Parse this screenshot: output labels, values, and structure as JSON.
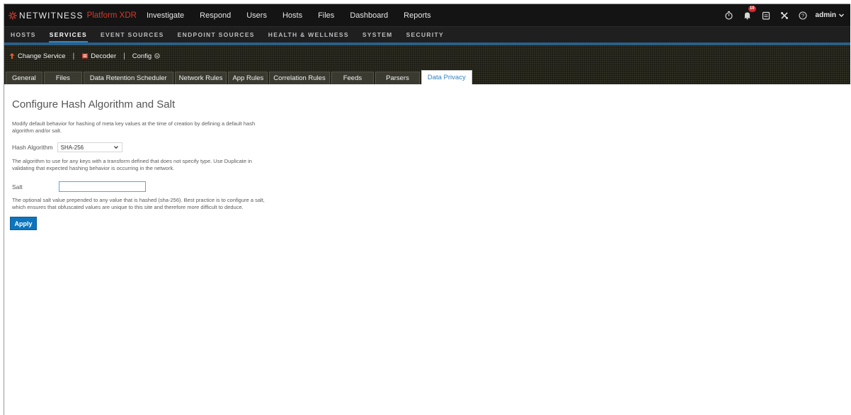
{
  "brand": {
    "name": "NETWITNESS",
    "sub": "Platform XDR"
  },
  "main_nav": [
    "Investigate",
    "Respond",
    "Users",
    "Hosts",
    "Files",
    "Dashboard",
    "Reports"
  ],
  "notifications": {
    "count": "10"
  },
  "user": {
    "name": "admin"
  },
  "sub_nav": {
    "items": [
      "HOSTS",
      "SERVICES",
      "EVENT SOURCES",
      "ENDPOINT SOURCES",
      "HEALTH & WELLNESS",
      "SYSTEM",
      "SECURITY"
    ],
    "active": "SERVICES"
  },
  "service_bar": {
    "change_service": "Change Service",
    "service": "Decoder",
    "view": "Config"
  },
  "tabs": {
    "items": [
      "General",
      "Files",
      "Data Retention Scheduler",
      "Network Rules",
      "App Rules",
      "Correlation Rules",
      "Feeds",
      "Parsers",
      "Data Privacy"
    ],
    "active": "Data Privacy"
  },
  "page": {
    "title": "Configure Hash Algorithm and Salt",
    "intro": "Modify default behavior for hashing of meta key values at the time of creation by defining a default hash algorithm and/or salt.",
    "hash_label": "Hash Algorithm",
    "hash_value": "SHA-256",
    "hash_help": "The algorithm to use for any keys with a transform defined that does not specify type. Use Duplicate in validating that expected hashing behavior is occurring in the network.",
    "salt_label": "Salt",
    "salt_value": "",
    "salt_help": "The optional salt value prepended to any value that is hashed (sha-256). Best practice is to configure a salt, which ensures that obfuscated values are unique to this site and therefore more difficult to deduce.",
    "apply_label": "Apply"
  },
  "colors": {
    "accent": "#0e75bd",
    "brand_red": "#d43a2c",
    "topbar": "#141414",
    "active_tab_text": "#2f7fc1"
  }
}
